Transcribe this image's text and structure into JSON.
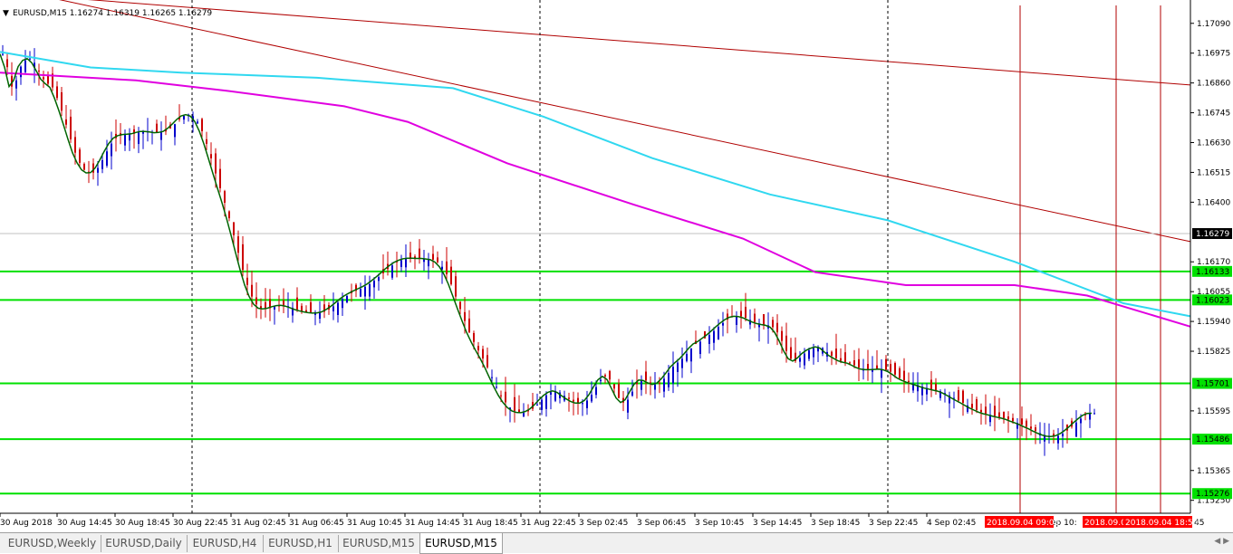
{
  "symbol_header": "EURUSD,M15  1.16274 1.16319 1.16265 1.16279",
  "price_labels": [
    "1.17090",
    "1.16975",
    "1.16860",
    "1.16745",
    "1.16630",
    "1.16515",
    "1.16400",
    "1.16170",
    "1.16055",
    "1.15940",
    "1.15825",
    "1.15595",
    "1.15365",
    "1.15250"
  ],
  "price_label_values": [
    1.1709,
    1.16975,
    1.1686,
    1.16745,
    1.1663,
    1.16515,
    1.164,
    1.1617,
    1.16055,
    1.1594,
    1.15825,
    1.15595,
    1.15365,
    1.1525
  ],
  "current_price": {
    "label": "1.16279",
    "value": 1.16279
  },
  "horizontal_levels": [
    {
      "label": "1.16133",
      "value": 1.16133
    },
    {
      "label": "1.16023",
      "value": 1.16023
    },
    {
      "label": "1.15701",
      "value": 1.15701
    },
    {
      "label": "1.15486",
      "value": 1.15486
    },
    {
      "label": "1.15276",
      "value": 1.15276
    }
  ],
  "time_labels": [
    "30 Aug 2018",
    "30 Aug 14:45",
    "30 Aug 18:45",
    "30 Aug 22:45",
    "31 Aug 02:45",
    "31 Aug 06:45",
    "31 Aug 10:45",
    "31 Aug 14:45",
    "31 Aug 18:45",
    "31 Aug 22:45",
    "3 Sep 02:45",
    "3 Sep 06:45",
    "3 Sep 10:45",
    "3 Sep 14:45",
    "3 Sep 18:45",
    "3 Sep 22:45",
    "4 Sep 02:45"
  ],
  "time_markers": [
    "2018.09.04 09:05",
    "2018.09.04 17:40",
    "2018.09.04 18:50"
  ],
  "time_marker_fragments": [
    "ep 10:",
    "45"
  ],
  "tabs": [
    {
      "label": "EURUSD,Weekly",
      "active": false
    },
    {
      "label": "EURUSD,Daily",
      "active": false
    },
    {
      "label": "EURUSD,H4",
      "active": false
    },
    {
      "label": "EURUSD,H1",
      "active": false
    },
    {
      "label": "EURUSD,M15",
      "active": false
    },
    {
      "label": "EURUSD,M15",
      "active": true
    }
  ],
  "colors": {
    "bull": "#0000cc",
    "bear": "#cc0000",
    "level": "#00e000",
    "ma_fast": "#006400",
    "ma_mid": "#e000e0",
    "ma_slow": "#30d8f0",
    "trend": "#b00000",
    "marker": "#b00000",
    "marker_label_bg": "#ff0000"
  },
  "chart_data": {
    "type": "candlestick",
    "x": [
      0,
      5,
      10,
      15,
      20,
      25,
      30,
      35,
      40,
      45,
      50,
      55,
      60,
      65,
      70,
      75,
      80,
      85,
      90,
      95,
      100,
      105,
      110,
      115,
      120,
      125,
      130,
      135,
      140,
      145,
      150,
      155,
      160,
      165,
      170,
      175,
      180,
      185,
      190,
      195,
      200,
      205,
      210,
      215,
      220,
      225,
      230,
      235,
      240,
      245,
      250,
      255,
      260,
      265,
      270,
      275,
      280,
      285,
      290,
      295,
      300,
      305,
      310,
      315,
      320,
      325,
      330,
      335,
      340,
      345,
      350,
      355,
      360,
      365,
      370,
      375,
      380,
      385,
      390,
      395,
      400,
      405,
      410,
      415,
      420,
      425,
      430,
      435,
      440,
      445,
      450,
      455,
      460,
      465,
      470,
      475,
      480,
      485,
      490,
      495,
      500,
      505,
      510,
      515,
      520,
      525,
      530,
      535,
      540,
      545,
      550,
      555,
      560,
      565,
      570,
      575,
      580,
      585,
      590,
      595,
      600,
      605,
      610,
      615,
      620,
      625,
      630,
      635,
      640,
      645,
      650,
      655,
      660,
      665,
      670,
      675,
      680,
      685,
      690,
      695,
      700,
      705,
      710,
      715,
      720,
      725,
      730,
      735,
      740,
      745,
      750,
      755,
      760,
      765,
      770,
      775,
      780,
      785,
      790,
      795,
      800,
      805,
      810,
      815,
      820,
      825,
      830,
      835,
      840,
      845,
      850,
      855,
      860,
      865,
      870,
      875,
      880,
      885,
      890,
      895,
      900,
      905,
      910,
      915,
      920,
      925,
      930,
      935,
      940,
      945,
      950,
      955,
      960,
      965,
      970,
      975,
      980,
      985,
      990,
      995,
      1000,
      1005,
      1010,
      1015,
      1020,
      1025,
      1030,
      1035,
      1040,
      1045,
      1050,
      1055,
      1060,
      1065,
      1070,
      1075,
      1080,
      1085,
      1090,
      1095,
      1100,
      1105,
      1110,
      1115,
      1120,
      1125,
      1130,
      1135,
      1140,
      1145,
      1150,
      1155,
      1160,
      1165,
      1170,
      1175,
      1180,
      1185,
      1190,
      1195,
      1200,
      1205,
      1210,
      1215,
      1220,
      1225,
      1230,
      1235,
      1240,
      1245,
      1250,
      1255,
      1260,
      1265,
      1270,
      1275,
      1280,
      1285,
      1290,
      1295,
      1300,
      1305,
      1310
    ],
    "close": [
      1.16972,
      1.16921,
      1.16846,
      1.1687,
      1.16923,
      1.16947,
      1.16954,
      1.16938,
      1.16907,
      1.16874,
      1.16857,
      1.16843,
      1.16802,
      1.16753,
      1.16699,
      1.16643,
      1.16591,
      1.16552,
      1.16525,
      1.16513,
      1.16514,
      1.16532,
      1.16562,
      1.16596,
      1.16626,
      1.16647,
      1.16657,
      1.16661,
      1.16662,
      1.16664,
      1.16669,
      1.16673,
      1.16673,
      1.16671,
      1.16668,
      1.16669,
      1.16673,
      1.16685,
      1.16701,
      1.16719,
      1.16733,
      1.16738,
      1.16732,
      1.16711,
      1.16674,
      1.16625,
      1.16569,
      1.16511,
      1.16454,
      1.16398,
      1.16338,
      1.16273,
      1.16205,
      1.16139,
      1.16081,
      1.16036,
      1.16006,
      1.15991,
      1.15988,
      1.15991,
      1.15997,
      1.16001,
      1.16002,
      1.15999,
      1.15993,
      1.15986,
      1.15981,
      1.15977,
      1.15974,
      1.15972,
      1.15973,
      1.15977,
      1.15986,
      1.15998,
      1.16012,
      1.16027,
      1.16039,
      1.16049,
      1.16058,
      1.16066,
      1.16074,
      1.16084,
      1.16097,
      1.16111,
      1.16126,
      1.16142,
      1.16156,
      1.16168,
      1.16176,
      1.16182,
      1.16184,
      1.16184,
      1.16183,
      1.16183,
      1.16181,
      1.16178,
      1.16169,
      1.16151,
      1.16122,
      1.16083,
      1.16036,
      1.15988,
      1.15942,
      1.15898,
      1.15861,
      1.15828,
      1.15797,
      1.15763,
      1.15725,
      1.15688,
      1.15655,
      1.15628,
      1.15608,
      1.15595,
      1.15589,
      1.15588,
      1.15593,
      1.15603,
      1.15619,
      1.15638,
      1.15655,
      1.15667,
      1.15672,
      1.15666,
      1.15653,
      1.15641,
      1.15631,
      1.15625,
      1.15625,
      1.15635,
      1.15657,
      1.15687,
      1.15715,
      1.15728,
      1.15716,
      1.15681,
      1.15645,
      1.15627,
      1.15638,
      1.15669,
      1.15698,
      1.15714,
      1.15712,
      1.15703,
      1.15697,
      1.15702,
      1.15719,
      1.15741,
      1.15765,
      1.15781,
      1.15796,
      1.15815,
      1.15836,
      1.15853,
      1.15862,
      1.15875,
      1.15888,
      1.15903,
      1.15919,
      1.15934,
      1.15947,
      1.15956,
      1.1596,
      1.15959,
      1.15954,
      1.15946,
      1.15938,
      1.15932,
      1.15928,
      1.15925,
      1.15918,
      1.15898,
      1.15865,
      1.15826,
      1.15796,
      1.15787,
      1.15799,
      1.15816,
      1.15829,
      1.15837,
      1.15842,
      1.15837,
      1.15822,
      1.15808,
      1.15798,
      1.15788,
      1.15783,
      1.15779,
      1.15771,
      1.15762,
      1.15756,
      1.15754,
      1.15754,
      1.15755,
      1.15756,
      1.15753,
      1.15746,
      1.15735,
      1.15722,
      1.15713,
      1.15706,
      1.157,
      1.15695,
      1.15689,
      1.15683,
      1.15679,
      1.15675,
      1.15671,
      1.15664,
      1.15655,
      1.15645,
      1.15635,
      1.15626,
      1.15616,
      1.15606,
      1.15598,
      1.1559,
      1.15584,
      1.1558,
      1.15575,
      1.15571,
      1.15567,
      1.15562,
      1.15555,
      1.15549,
      1.15542,
      1.15534,
      1.15526,
      1.15517,
      1.15509,
      1.15502,
      1.15497,
      1.15496,
      1.15499,
      1.15507,
      1.15519,
      1.15534,
      1.1555,
      1.15565,
      1.15578,
      1.15585,
      1.15586
    ]
  }
}
